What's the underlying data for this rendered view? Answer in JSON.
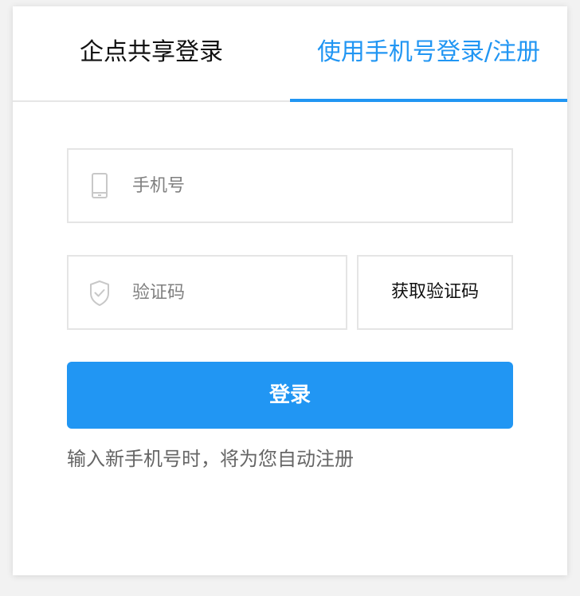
{
  "tabs": {
    "enterprise_login": "企点共享登录",
    "phone_login": "使用手机号登录/注册",
    "active": "phone_login"
  },
  "form": {
    "phone_placeholder": "手机号",
    "phone_value": "",
    "code_placeholder": "验证码",
    "code_value": "",
    "get_code_label": "获取验证码",
    "login_label": "登录",
    "hint": "输入新手机号时，将为您自动注册"
  },
  "icons": {
    "phone_field_icon": "mobile-phone-icon",
    "code_field_icon": "shield-check-icon"
  },
  "colors": {
    "accent": "#2196f3",
    "border": "#e5e5e5",
    "icon_gray": "#c8c8c8",
    "hint_text": "#666666"
  }
}
